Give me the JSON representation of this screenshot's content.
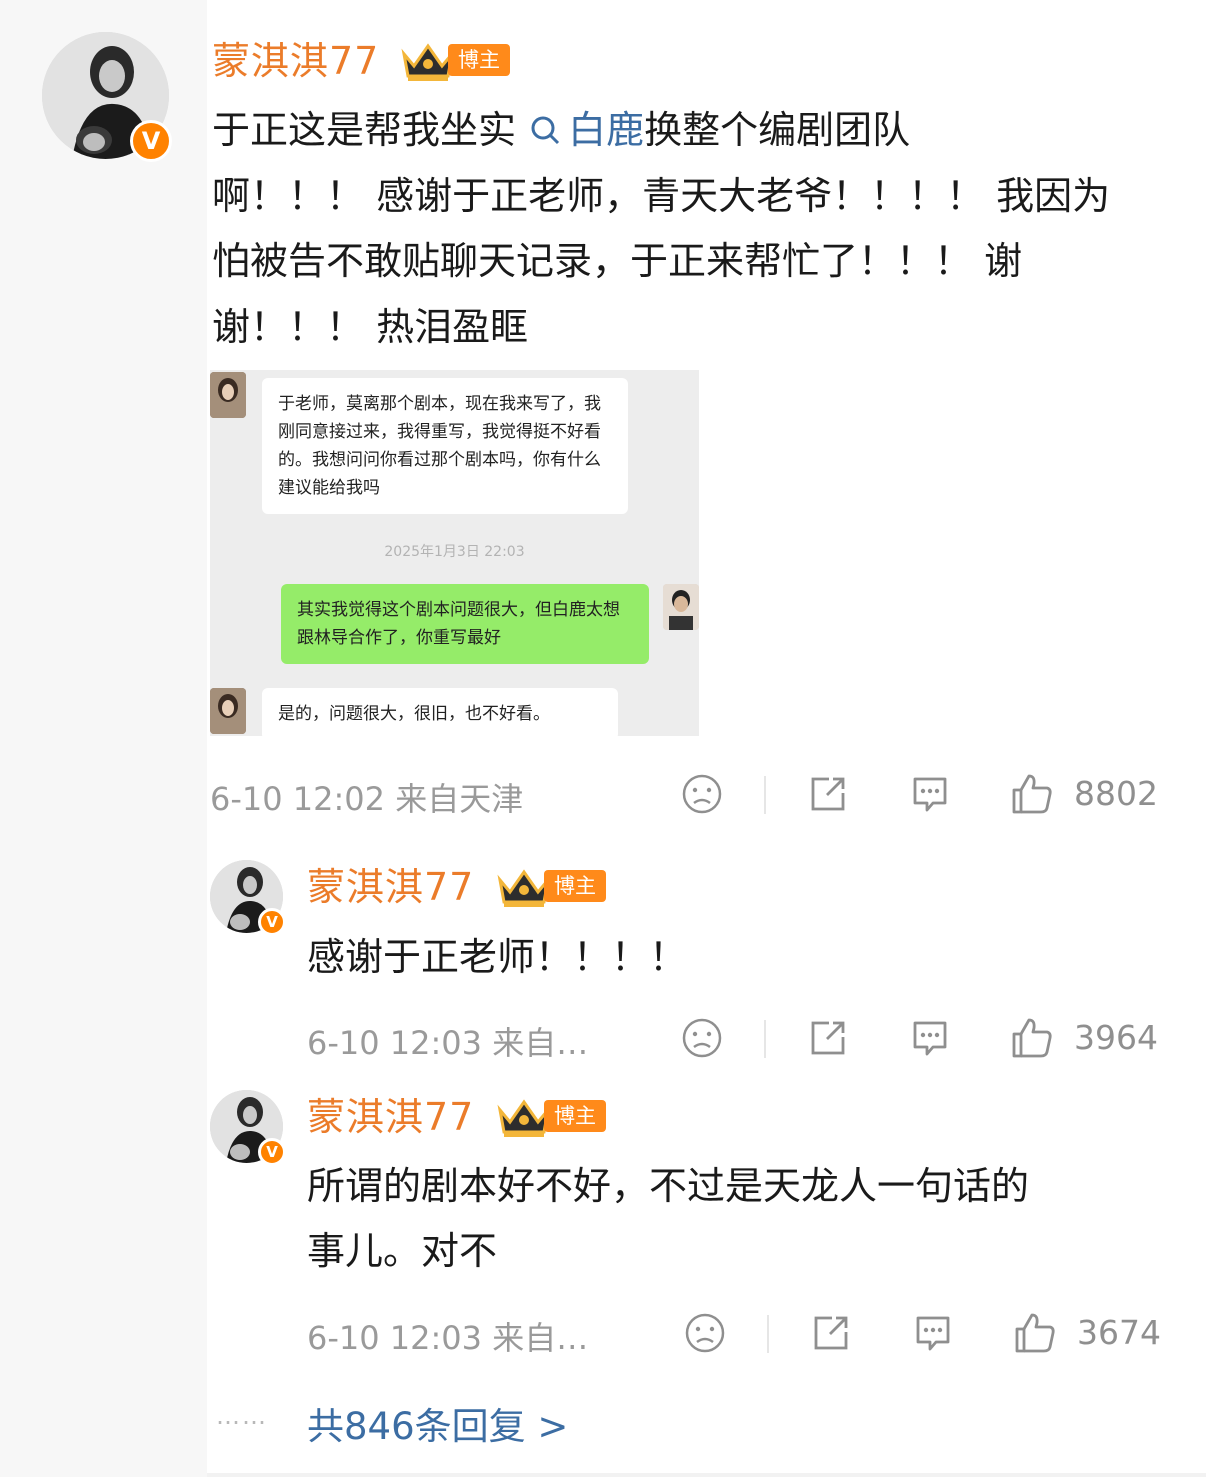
{
  "post": {
    "username": "蒙淇淇77",
    "badge": "博主",
    "text_before": "于正这是帮我坐实 ",
    "link_text": "白鹿",
    "text_after_l1": "换整个编剧团队",
    "text_l2": "啊！！！ 感谢于正老师，青天大老爷！！！！ 我因为",
    "text_l3": "怕被告不敢贴聊天记录，于正来帮忙了！！！ 谢",
    "text_l4": "谢！！！ 热泪盈眶",
    "meta": "6-10 12:02  来自天津",
    "likes": "8802"
  },
  "screenshot": {
    "msg1": "于老师，莫离那个剧本，现在我来写了，我刚同意接过来，我得重写，我觉得挺不好看的。我想问问你看过那个剧本吗，你有什么建议能给我吗",
    "timestamp": "2025年1月3日 22:03",
    "msg2": "其实我觉得这个剧本问题很大，但白鹿太想跟林导合作了，你重写最好",
    "msg3": "是的，问题很大，很旧，也不好看。"
  },
  "replies": [
    {
      "username": "蒙淇淇77",
      "badge": "博主",
      "text": "感谢于正老师！！！！",
      "meta": "6-10 12:03  来自…",
      "likes": "3964"
    },
    {
      "username": "蒙淇淇77",
      "badge": "博主",
      "text_l1": "所谓的剧本好不好，不过是天龙人一句话的",
      "text_l2": "事儿。对不",
      "meta": "6-10 12:03  来自…",
      "likes": "3674"
    }
  ],
  "footer": {
    "dots": "……",
    "more": "共846条回复 >"
  },
  "icons": [
    "search-icon",
    "dislike-icon",
    "share-icon",
    "comment-icon",
    "like-icon",
    "crown-icon",
    "verified-icon"
  ],
  "colors": {
    "username": "#eb7c2a",
    "badge": "#ff8a1a",
    "link": "#3c6da3",
    "meta": "#9a9a9a",
    "wechat_green": "#95ec69"
  }
}
